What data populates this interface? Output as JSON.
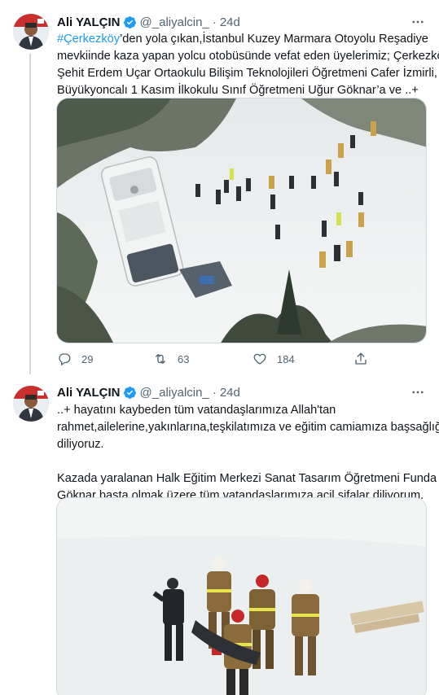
{
  "tweets": [
    {
      "author": {
        "name": "Ali YALÇIN",
        "handle": "@_aliyalcin_",
        "time": "24d"
      },
      "text": {
        "hashtag": "#Çerkezköy",
        "line1_rest": "’den yola çıkan,İstanbul Kuzey Marmara Otoyolu Reşadiye",
        "line2": "mevkiinde kaza yapan yolcu otobüsünde vefat eden üyelerimiz; Çerkezköy",
        "line3": "Şehit Erdem Uçar Ortaokulu Bilişim Teknolojileri Öğretmeni Cafer İzmirli,",
        "line4": "Büyükyoncalı 1 Kasım İlkokulu Sınıf Öğretmeni Uğur Göknar’a ve ..+"
      },
      "metrics": {
        "replies": "29",
        "retweets": "63",
        "likes": "184"
      }
    },
    {
      "author": {
        "name": "Ali YALÇIN",
        "handle": "@_aliyalcin_",
        "time": "24d"
      },
      "text": {
        "line1": "..+ hayatını kaybeden tüm vatandaşlarımıza Allah'tan",
        "line2": "rahmet,ailelerine,yakınlarına,teşkilatımıza ve eğitim camiamıza başsağlığı",
        "line3": "diliyoruz.",
        "line4": "Kazada yaralanan Halk Eğitim Merkezi Sanat Tasarım Öğretmeni Funda Kır",
        "line5": "Göknar başta olmak üzere tüm vatandaşlarımıza acil şifalar diliyorum."
      }
    }
  ],
  "icons": {
    "verified": "verified-badge-icon",
    "more": "more-icon",
    "reply": "reply-icon",
    "retweet": "retweet-icon",
    "like": "like-icon",
    "share": "share-icon"
  },
  "colors": {
    "accent": "#1d9bf0",
    "text": "#0f1419",
    "muted": "#536471",
    "border": "#cfd9de"
  }
}
